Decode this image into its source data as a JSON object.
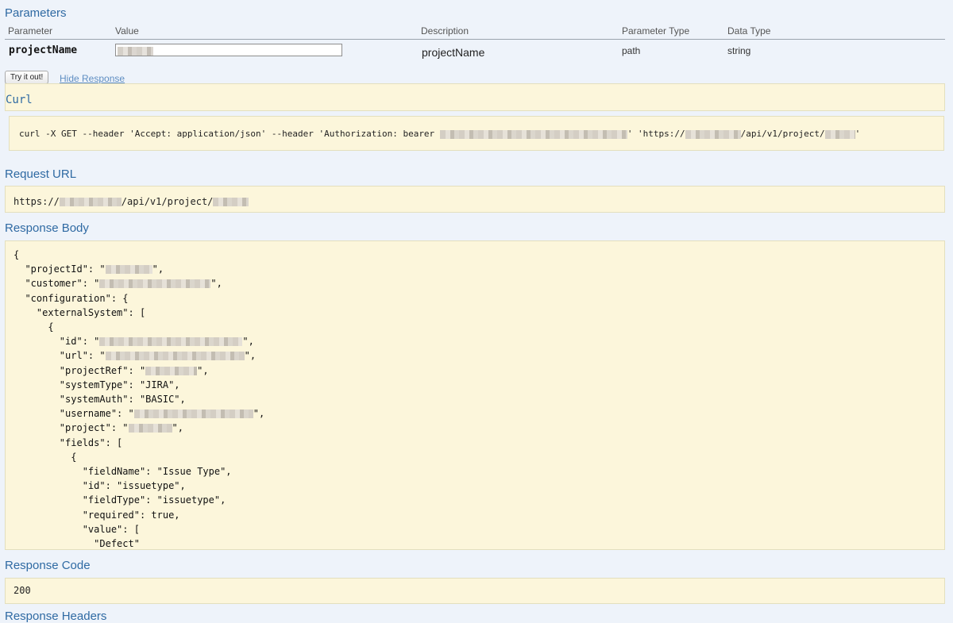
{
  "parameters": {
    "title": "Parameters",
    "headers": {
      "parameter": "Parameter",
      "value": "Value",
      "description": "Description",
      "parameter_type": "Parameter Type",
      "data_type": "Data Type"
    },
    "row": {
      "name": "projectName",
      "value": "",
      "description": "projectName",
      "parameter_type": "path",
      "data_type": "string"
    }
  },
  "actions": {
    "try_label": "Try it out!",
    "hide_label": "Hide Response"
  },
  "curl": {
    "title": "Curl",
    "prefix": "curl -X GET --header 'Accept: application/json' --header 'Authorization: bearer ",
    "middle": "' 'https://",
    "path": "/api/v1/project/",
    "suffix": "'"
  },
  "request_url": {
    "title": "Request URL",
    "prefix": "https://",
    "path": "/api/v1/project/"
  },
  "response_body": {
    "title": "Response Body",
    "lines": [
      "{",
      "  \"projectId\": \"\",",
      "  \"customer\": \"\",",
      "  \"configuration\": {",
      "    \"externalSystem\": [",
      "      {",
      "        \"id\": \"\",",
      "        \"url\": \"\",",
      "        \"projectRef\": \"\",",
      "        \"systemType\": \"JIRA\",",
      "        \"systemAuth\": \"BASIC\",",
      "        \"username\": \"\",",
      "        \"project\": \"\",",
      "        \"fields\": [",
      "          {",
      "            \"fieldName\": \"Issue Type\",",
      "            \"id\": \"issuetype\",",
      "            \"fieldType\": \"issuetype\",",
      "            \"required\": true,",
      "            \"value\": [",
      "              \"Defect\""
    ]
  },
  "response_code": {
    "title": "Response Code",
    "value": "200"
  },
  "response_headers": {
    "title": "Response Headers"
  }
}
